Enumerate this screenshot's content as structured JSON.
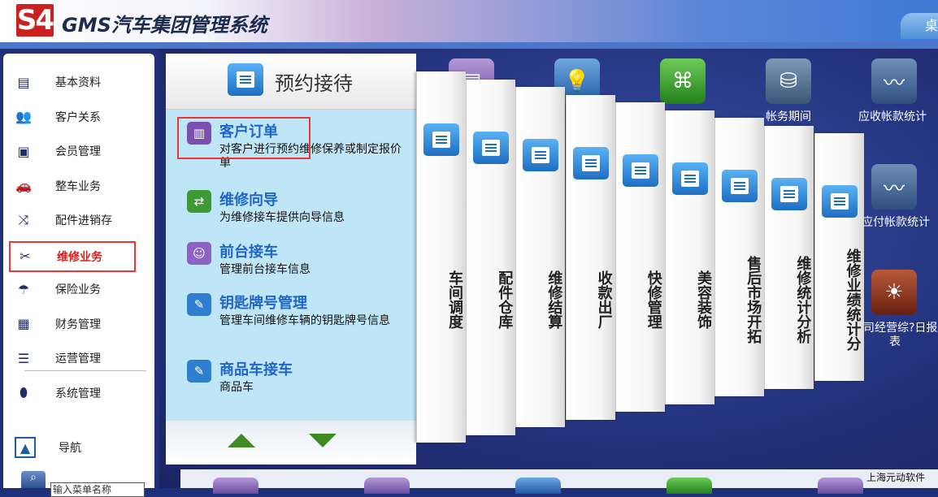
{
  "header": {
    "logo_text": "S4",
    "title": "GMS汽车集团管理系统",
    "desktop_tab": "桌"
  },
  "sidebar": {
    "items": [
      {
        "label": "基本资料",
        "icon": "book-icon"
      },
      {
        "label": "客户关系",
        "icon": "users-icon"
      },
      {
        "label": "会员管理",
        "icon": "member-card-icon"
      },
      {
        "label": "整车业务",
        "icon": "car-icon"
      },
      {
        "label": "配件进销存",
        "icon": "shuffle-icon"
      },
      {
        "label": "维修业务",
        "icon": "tools-icon",
        "active": true
      },
      {
        "label": "保险业务",
        "icon": "umbrella-icon"
      },
      {
        "label": "财务管理",
        "icon": "calculator-icon"
      },
      {
        "label": "运营管理",
        "icon": "list-icon"
      },
      {
        "label": "系统管理",
        "icon": "mouse-icon"
      }
    ],
    "nav_label": "导航",
    "search_value": "输入菜单名称"
  },
  "desktop": {
    "labels": {
      "account_period": "帐务期间",
      "receivable_stats": "应收帐款统计",
      "payable_stats": "应付帐款统计",
      "daily_report_line1": "司经营综?日报",
      "daily_report_line2": "表"
    },
    "company": "上海元动软件"
  },
  "panel": {
    "title": "预约接待",
    "items": [
      {
        "title": "客户订单",
        "desc": "对客户进行预约维修保养或制定报价单",
        "color": "#7b4fb0"
      },
      {
        "title": "维修向导",
        "desc": "为维修接车提供向导信息",
        "color": "#3f9a35"
      },
      {
        "title": "前台接车",
        "desc": "管理前台接车信息",
        "color": "#8a63c4"
      },
      {
        "title": "钥匙牌号管理",
        "desc": "管理车间维修车辆的钥匙牌号信息",
        "color": "#2f7fd0"
      },
      {
        "title": "商品车接车",
        "desc": "商品车",
        "color": "#2f7fd0"
      }
    ]
  },
  "columns": [
    {
      "label": "车间调度"
    },
    {
      "label": "配件仓库"
    },
    {
      "label": "维修结算"
    },
    {
      "label": "收款出厂"
    },
    {
      "label": "快修管理"
    },
    {
      "label": "美容装饰"
    },
    {
      "label": "售后市场开拓"
    },
    {
      "label": "维修统计分析"
    },
    {
      "label": "维修业绩统计分"
    }
  ]
}
